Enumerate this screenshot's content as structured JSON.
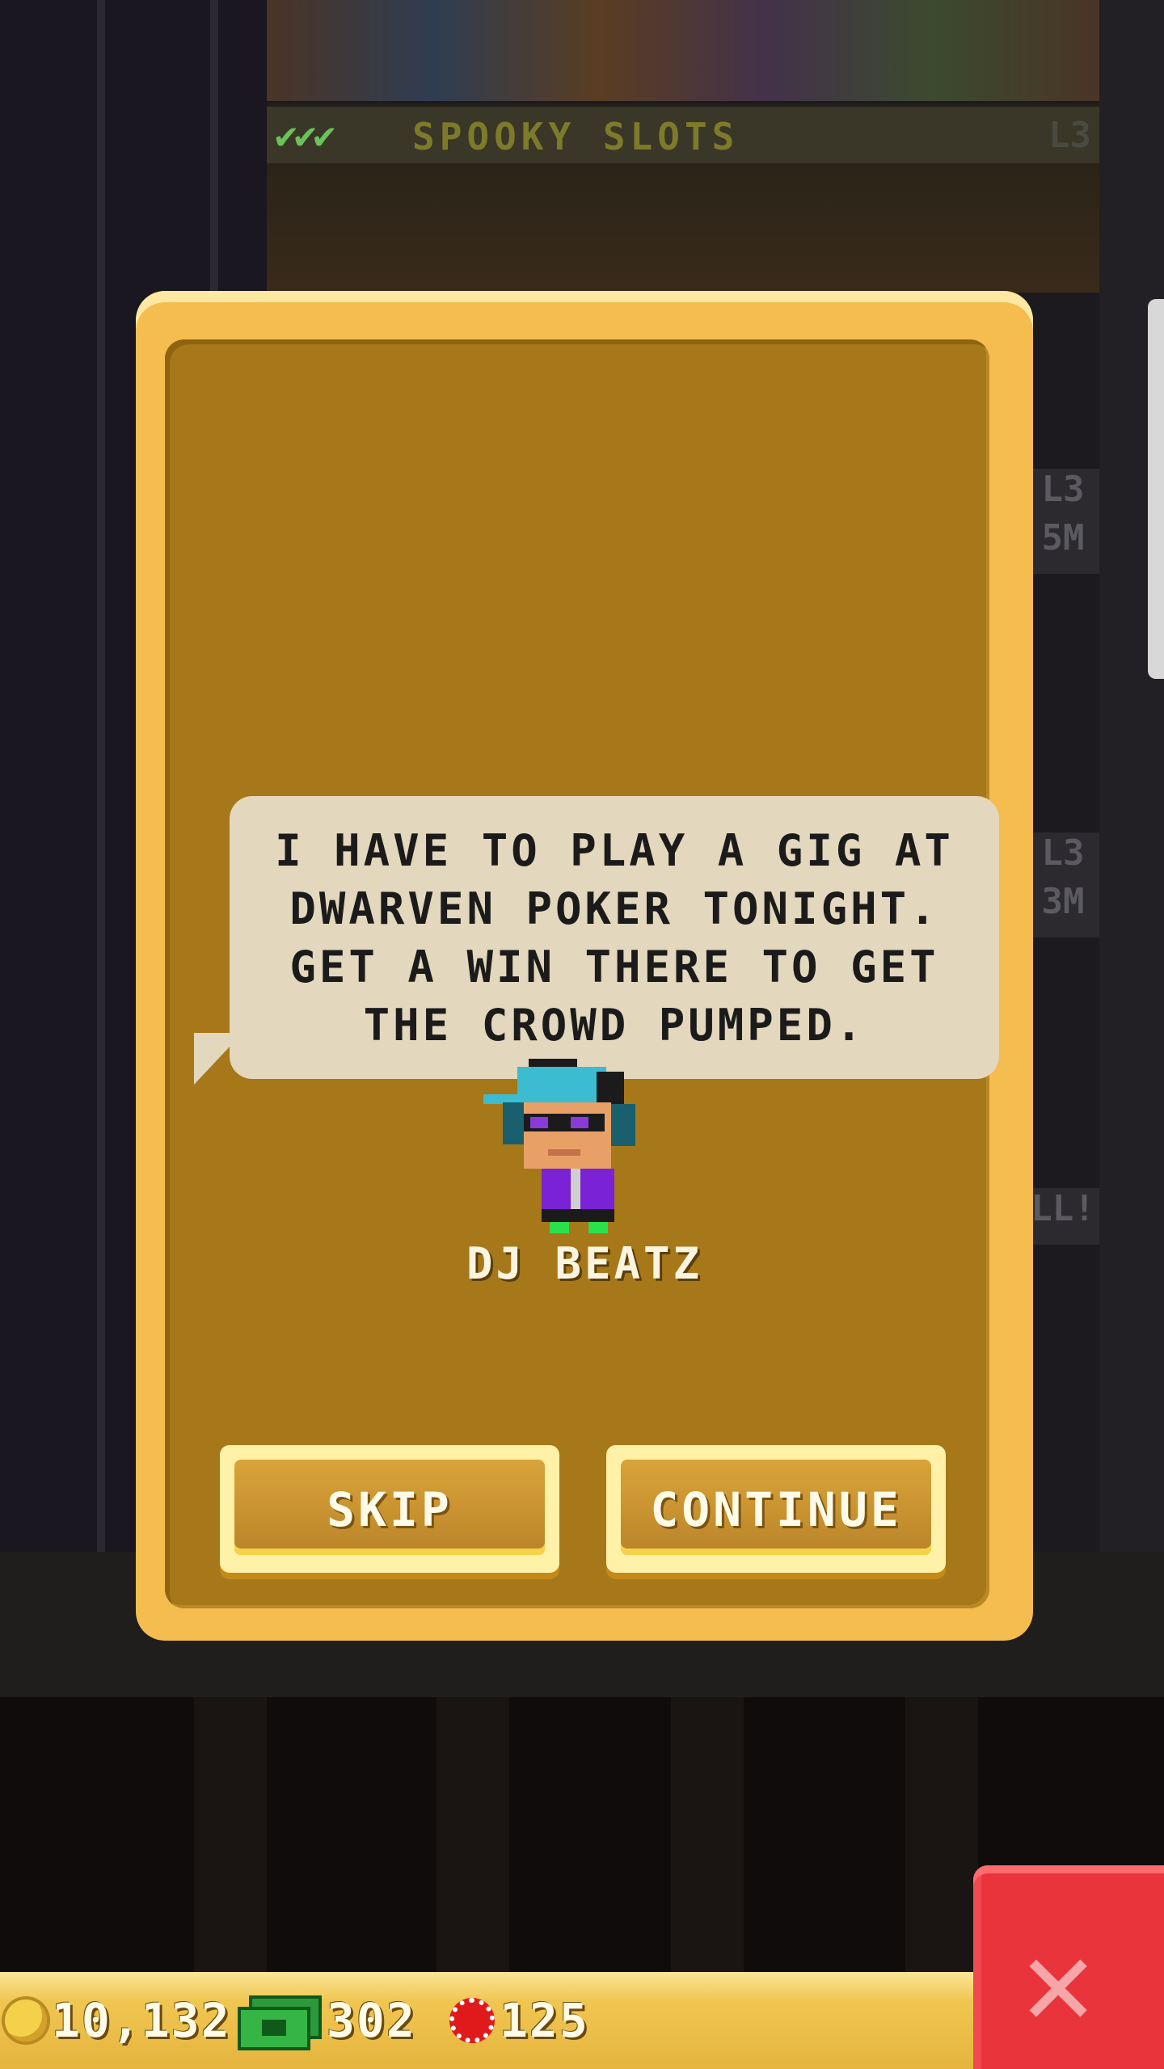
{
  "background": {
    "floor_checks": "✔✔✔",
    "floor_name": "SPOOKY SLOTS",
    "floor_level": "L3",
    "side_labels": [
      "L3",
      "5M",
      "L3",
      "3M",
      "LL!"
    ]
  },
  "dialog": {
    "message": "I HAVE TO PLAY A GIG AT\nDWARVEN POKER TONIGHT.\nGET A WIN THERE TO GET\nTHE CROWD PUMPED.",
    "character_name": "DJ BEATZ",
    "skip_label": "SKIP",
    "continue_label": "CONTINUE"
  },
  "status_bar": {
    "coins": "10,132",
    "bux": "302",
    "chips": "125"
  },
  "icons": {
    "coin": "coin-icon",
    "cash": "cash-icon",
    "chip": "chip-icon",
    "close": "close-icon"
  },
  "colors": {
    "dialog_border": "#f5bc4f",
    "dialog_fill": "#a67819",
    "bubble": "#e3d7bd",
    "close_button": "#e8343a",
    "status_bar": "#f0c651"
  }
}
